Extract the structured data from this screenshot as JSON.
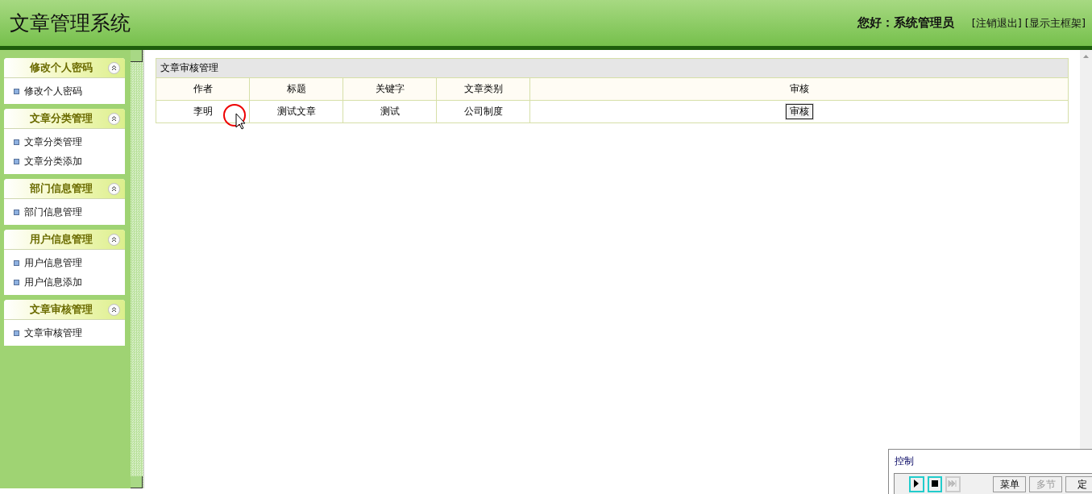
{
  "header": {
    "title": "文章管理系统",
    "greeting": "您好：系统管理员",
    "links": [
      "[注销退出]",
      "[显示主框架]"
    ]
  },
  "sidebar": {
    "groups": [
      {
        "title": "修改个人密码",
        "expanded": true,
        "items": [
          "修改个人密码"
        ]
      },
      {
        "title": "文章分类管理",
        "expanded": true,
        "items": [
          "文章分类管理",
          "文章分类添加"
        ]
      },
      {
        "title": "部门信息管理",
        "expanded": true,
        "items": [
          "部门信息管理"
        ]
      },
      {
        "title": "用户信息管理",
        "expanded": true,
        "items": [
          "用户信息管理",
          "用户信息添加"
        ]
      },
      {
        "title": "文章审核管理",
        "expanded": true,
        "items": [
          "文章审核管理"
        ]
      }
    ]
  },
  "table": {
    "title": "文章审核管理",
    "columns": [
      "作者",
      "标题",
      "关键字",
      "文章类别",
      "审核"
    ],
    "rows": [
      {
        "cells": [
          "李明",
          "测试文章",
          "测试",
          "公司制度"
        ],
        "action": "审核"
      }
    ]
  },
  "control_window": {
    "title": "控制",
    "buttons": [
      {
        "kind": "play",
        "disabled": false
      },
      {
        "kind": "stop",
        "disabled": false
      },
      {
        "kind": "skip",
        "disabled": true
      },
      {
        "kind": "text",
        "label": "菜单",
        "disabled": false
      },
      {
        "kind": "text",
        "label": "多节",
        "disabled": true
      },
      {
        "kind": "text",
        "label": "定",
        "disabled": false
      }
    ]
  }
}
